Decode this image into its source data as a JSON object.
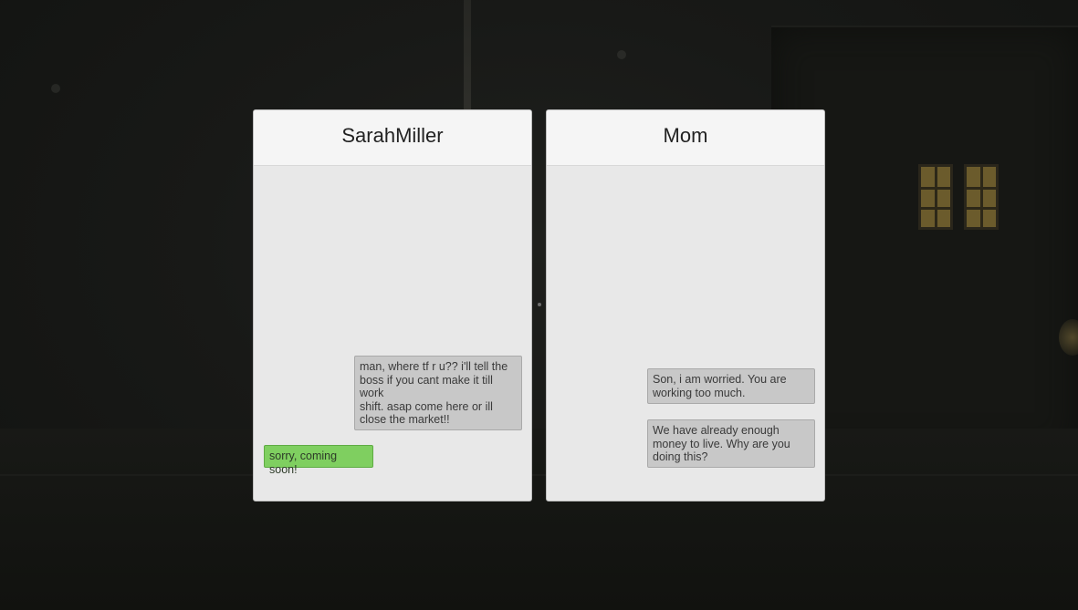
{
  "conversations": [
    {
      "contact_name": "SarahMiller",
      "messages": [
        {
          "sender": "contact",
          "text": " man, where tf r u?? i'll tell the boss if you cant make it till work\nshift. asap come here or ill close the market!!"
        },
        {
          "sender": "player",
          "text": "sorry, coming soon!"
        }
      ]
    },
    {
      "contact_name": "Mom",
      "messages": [
        {
          "sender": "contact",
          "text": "Son, i am worried. You are working too much."
        },
        {
          "sender": "contact",
          "text": "We have already enough money to live. Why are you doing this?"
        }
      ]
    }
  ],
  "colors": {
    "incoming_bubble": "#c8c8c8",
    "outgoing_bubble": "#7fcf60",
    "panel_body": "#e8e8e8",
    "panel_header": "#f5f5f5"
  }
}
